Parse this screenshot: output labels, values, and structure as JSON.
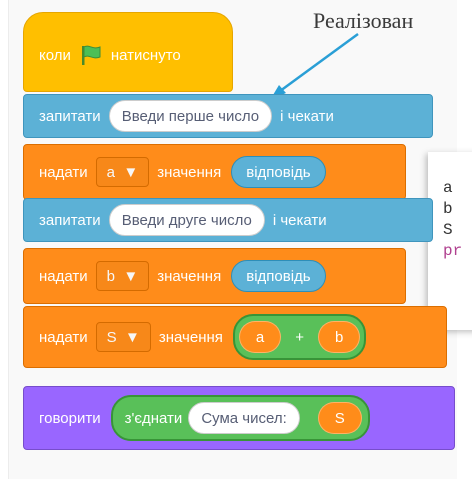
{
  "caption": "Реалізован",
  "code_lines": [
    "a",
    "b",
    "S",
    "pr"
  ],
  "blocks": {
    "hat": {
      "label1": "коли",
      "flag_icon": "green-flag-icon",
      "label2": "натиснуто"
    },
    "ask1": {
      "label": "запитати",
      "input": "Введи перше число",
      "label2": "і чекати"
    },
    "set1": {
      "label": "надати",
      "var": "a",
      "label2": "значення",
      "reporter": "відповідь"
    },
    "ask2": {
      "label": "запитати",
      "input": "Введи друге число",
      "label2": "і чекати"
    },
    "set2": {
      "label": "надати",
      "var": "b",
      "label2": "значення",
      "reporter": "відповідь"
    },
    "set3": {
      "label": "надати",
      "var": "S",
      "label2": "значення",
      "left": "a",
      "op": "+",
      "right": "b"
    },
    "say": {
      "label": "говорити",
      "join": "з'єднати",
      "input": "Сума чисел:",
      "var": "S"
    }
  },
  "colors": {
    "events": "#ffbf00",
    "sensing": "#5cb1d6",
    "variables": "#ff8c1a",
    "looks": "#9966ff",
    "operators": "#59c059",
    "arrow": "#2a9fd6"
  }
}
